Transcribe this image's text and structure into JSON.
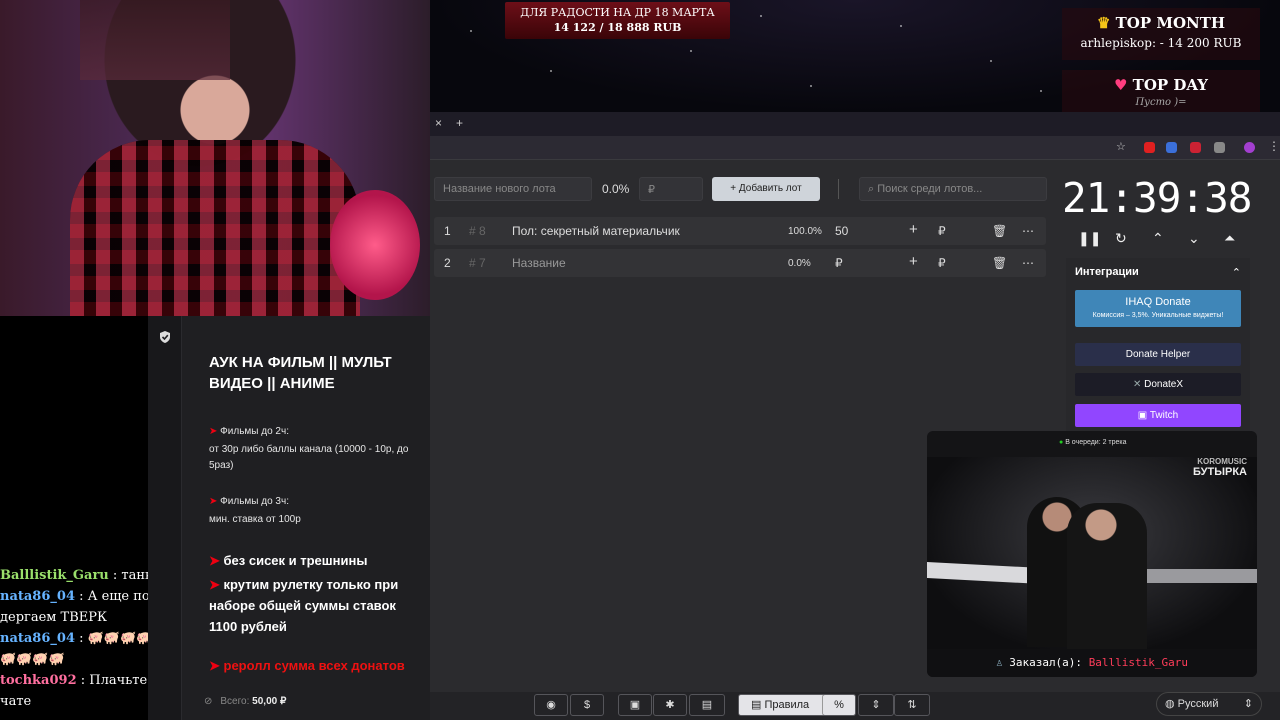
{
  "overlay": {
    "goal_title": "ДЛЯ РАДОСТИ НА ДР 18 МАРТА",
    "goal_amount": "14 122 / 18 888 RUB",
    "top_month_title": "TOP MONTH",
    "top_month_value": "arhlepiskop: - 14 200 RUB",
    "top_day_title": "TOP DAY",
    "top_day_value": "Пусто )="
  },
  "chat": [
    {
      "name": "Balllistik_Garu",
      "sep": " : ",
      "text": "танкисты",
      "cls": "n1"
    },
    {
      "name": "nata86_04",
      "sep": " : ",
      "text": "А еще попами дергаем ТВЕРК",
      "cls": "n2"
    },
    {
      "name": "nata86_04",
      "sep": " : ",
      "text": "🐖🐖🐖🐖🐖🐖🐖🐖🐖🐖🐖🐖🐖",
      "cls": "n2"
    },
    {
      "name": "tochka092",
      "sep": " : ",
      "text": "Плачьте сучки, я в чате",
      "cls": "n3"
    }
  ],
  "rules": {
    "title": "АУК НА ФИЛЬМ || МУЛЬТ ВИДЕО || АНИМЕ",
    "s1_head": "Фильмы до 2ч:",
    "s1_body": "от 30р либо баллы канала (10000 - 10р, до 5раз)",
    "s2_head": "Фильмы до 3ч:",
    "s2_body": "мин. ставка от 100р",
    "b1": "без сисек и трешнины",
    "b2": "крутим рулетку только при наборе общей суммы ставок 1100 рублей",
    "b3": "реролл сумма всех донатов"
  },
  "browser": {
    "close_tab": "×",
    "new_tab": "+"
  },
  "auction": {
    "new_lot_placeholder": "Название нового лота",
    "new_lot_percent": "0.0%",
    "amount_placeholder": "₽",
    "add_button": "Добавить лот",
    "search_placeholder": "Поиск среди лотов...",
    "currency": "₽",
    "lots": [
      {
        "num": "1",
        "id": "# 8",
        "name": "Пол: секретный материальчик",
        "percent": "100.0%",
        "amount": "50"
      },
      {
        "num": "2",
        "id": "# 7",
        "name": "Название",
        "percent": "0.0%",
        "amount": "₽"
      }
    ],
    "timer": "21:39:38",
    "integrations_title": "Интеграции",
    "integrations": [
      {
        "label": "IHAQ Donate",
        "sub": "Комиссия – 3,5%. Уникальные виджеты!",
        "color": "#3f86b8"
      },
      {
        "label": "Donate Helper",
        "color": "#2a2f4a"
      },
      {
        "label": "DonateX",
        "color": "#1c1c26"
      },
      {
        "label": "Twitch",
        "color": "#9146ff"
      }
    ],
    "total_label": "Всего:",
    "total_value": "50,00 ₽",
    "rules_button": "Правила",
    "language": "Русский"
  },
  "video": {
    "queue": "В очереди: 2 трека",
    "brand": "KOROMUSIC",
    "song": "БУТЫРКА",
    "ordered_by_label": "Заказал(а):",
    "ordered_by": "Balllistik_Garu"
  },
  "colors": {
    "accent_red": "#e11b1b",
    "app_bg": "#2b2b2e",
    "twitch": "#9146ff"
  }
}
